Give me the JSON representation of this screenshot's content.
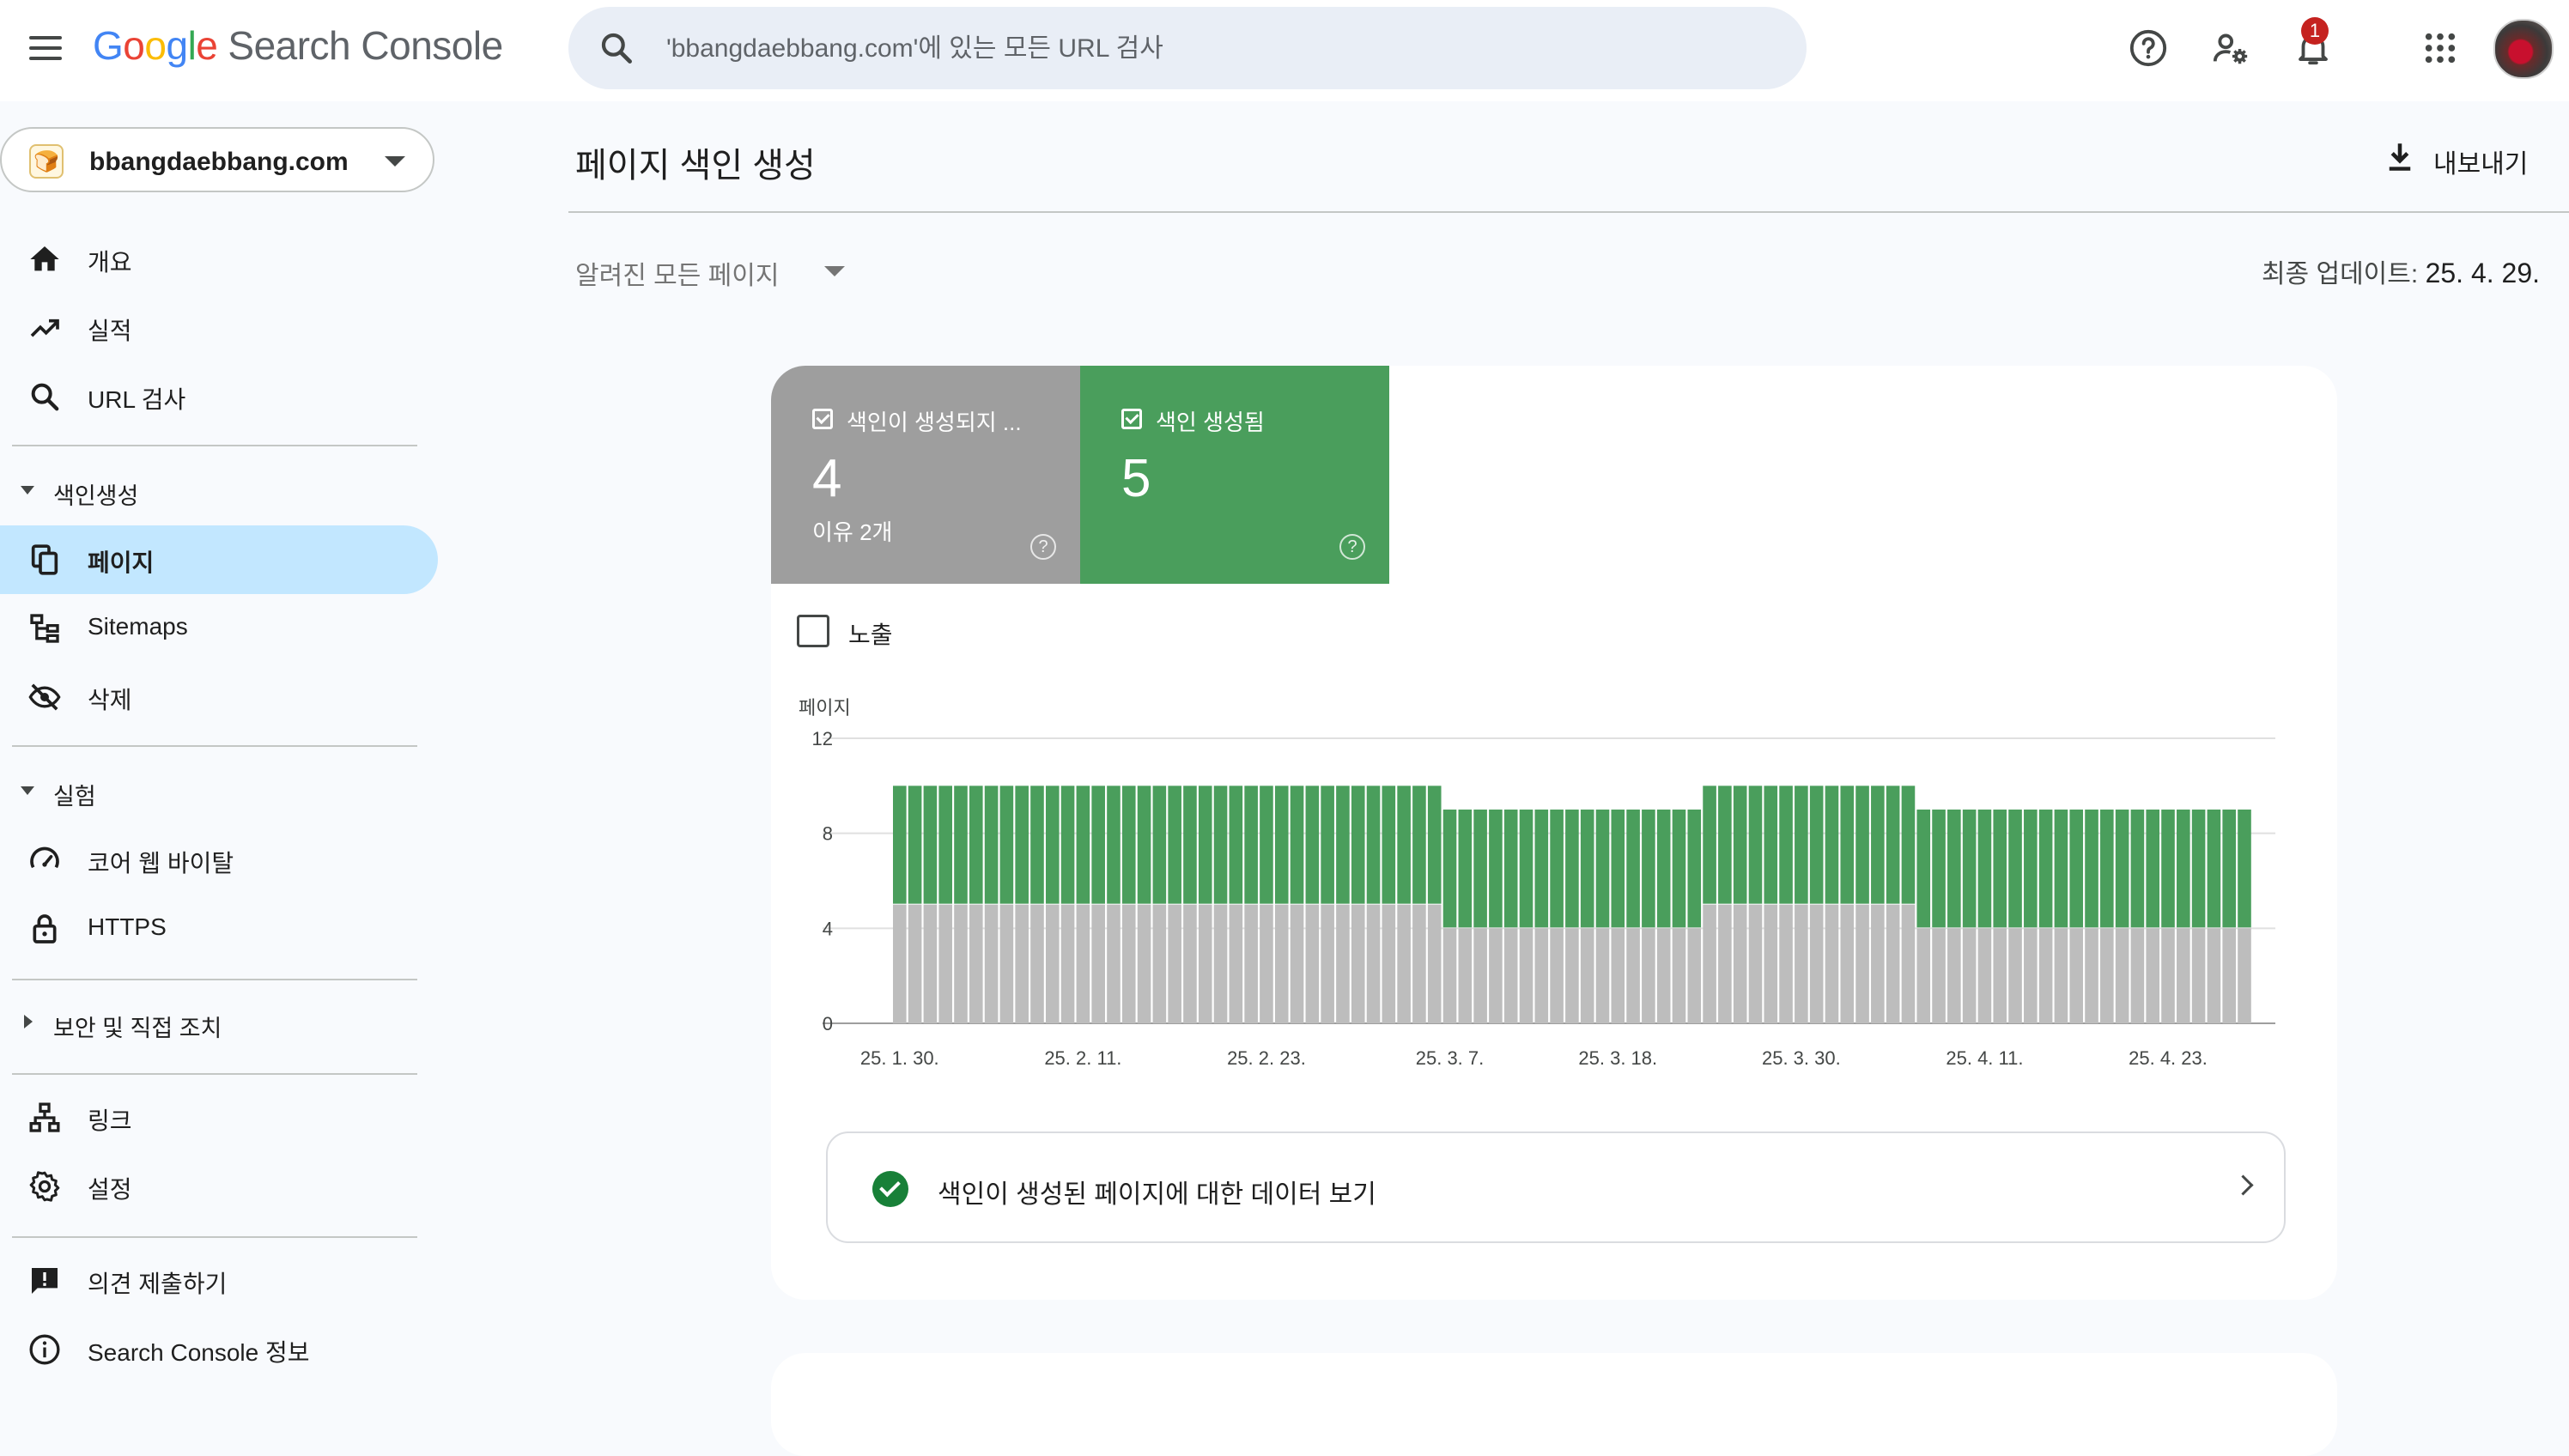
{
  "app": {
    "logo_google": [
      "G",
      "o",
      "o",
      "g",
      "l",
      "e"
    ],
    "logo_product": "Search Console"
  },
  "search": {
    "placeholder": "'bbangdaebbang.com'에 있는 모든 URL 검사"
  },
  "topbar": {
    "notification_count": "1"
  },
  "property": {
    "name": "bbangdaebbang.com"
  },
  "sidebar": {
    "items": [
      {
        "label": "개요",
        "icon": "home-icon"
      },
      {
        "label": "실적",
        "icon": "trending-up-icon"
      },
      {
        "label": "URL 검사",
        "icon": "search-icon"
      }
    ],
    "section_indexing": "색인생성",
    "indexing_items": [
      {
        "label": "페이지",
        "icon": "pages-icon",
        "active": true
      },
      {
        "label": "Sitemaps",
        "icon": "sitemap-icon"
      },
      {
        "label": "삭제",
        "icon": "eye-off-icon"
      }
    ],
    "section_experience": "실험",
    "experience_items": [
      {
        "label": "코어 웹 바이탈",
        "icon": "speedometer-icon"
      },
      {
        "label": "HTTPS",
        "icon": "lock-icon"
      }
    ],
    "section_security": "보안 및 직접 조치",
    "other_items": [
      {
        "label": "링크",
        "icon": "links-icon"
      },
      {
        "label": "설정",
        "icon": "gear-icon"
      }
    ],
    "footer_items": [
      {
        "label": "의견 제출하기",
        "icon": "feedback-icon"
      },
      {
        "label": "Search Console 정보",
        "icon": "info-icon"
      }
    ]
  },
  "main": {
    "title": "페이지 색인 생성",
    "export_label": "내보내기",
    "filter_label": "알려진 모든 페이지",
    "updated_label": "최종 업데이트:",
    "updated_value": "25. 4. 29."
  },
  "tiles": {
    "not_indexed": {
      "label": "색인이 생성되지 ...",
      "value": "4",
      "sub": "이유 2개"
    },
    "indexed": {
      "label": "색인 생성됨",
      "value": "5"
    }
  },
  "impressions_label": "노출",
  "cta_label": "색인이 생성된 페이지에 대한 데이터 보기",
  "colors": {
    "not_indexed": "#bdbdbd",
    "indexed": "#4a9e5c",
    "accent": "#c2e7ff"
  },
  "chart_data": {
    "type": "bar",
    "stacked": true,
    "ylabel": "페이지",
    "ylim": [
      0,
      12
    ],
    "yticks": [
      0,
      4,
      8,
      12
    ],
    "xtick_labels": [
      "25. 1. 30.",
      "25. 2. 11.",
      "25. 2. 23.",
      "25. 3. 7.",
      "25. 3. 18.",
      "25. 3. 30.",
      "25. 4. 11.",
      "25. 4. 23."
    ],
    "xtick_positions": [
      0,
      12,
      24,
      36,
      47,
      59,
      71,
      83
    ],
    "n_bars": 89,
    "series": [
      {
        "name": "색인이 생성되지 않음",
        "color": "#bdbdbd",
        "segments": [
          {
            "count": 36,
            "value": 5
          },
          {
            "count": 17,
            "value": 4
          },
          {
            "count": 14,
            "value": 5
          },
          {
            "count": 22,
            "value": 4
          }
        ]
      },
      {
        "name": "색인 생성됨",
        "color": "#4a9e5c",
        "segments": [
          {
            "count": 36,
            "value": 5
          },
          {
            "count": 17,
            "value": 5
          },
          {
            "count": 14,
            "value": 5
          },
          {
            "count": 22,
            "value": 5
          }
        ]
      }
    ]
  }
}
